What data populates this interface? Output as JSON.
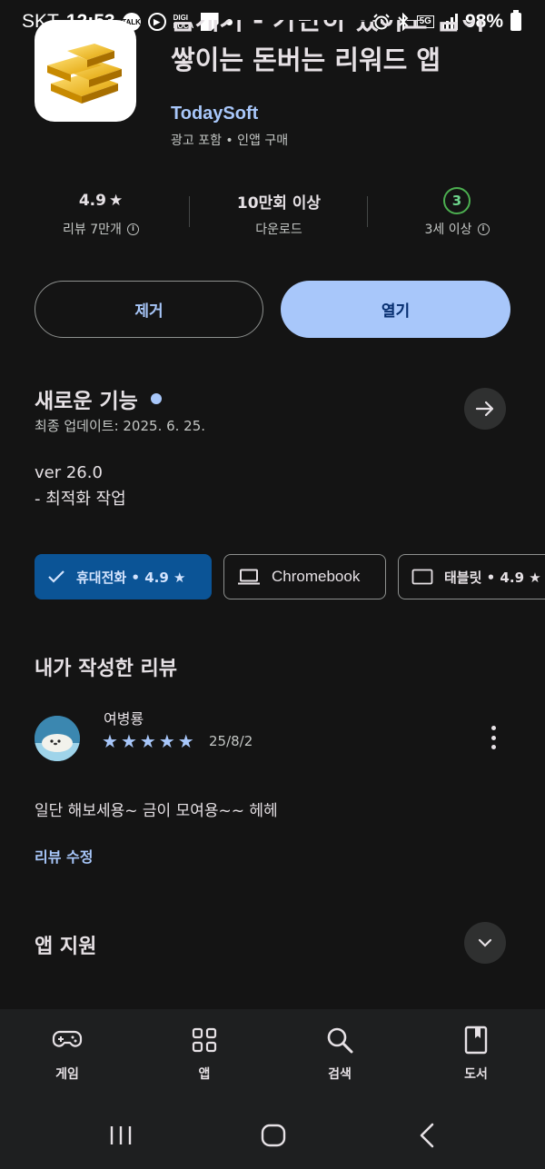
{
  "status_bar": {
    "carrier": "SKT",
    "time": "12:53",
    "talk_icon_text": "TALK",
    "digi_text": "DIGI LOCA",
    "network": "5G",
    "battery": "98%"
  },
  "app": {
    "title_line1": "금캐기 - 가만히 있어도 금이",
    "title_line2": "쌓이는 돈버는 리워드 앱",
    "developer": "TodaySoft",
    "meta": "광고 포함 • 인앱 구매"
  },
  "stats": {
    "rating_value": "4.9",
    "rating_label": "리뷰 7만개",
    "downloads_value": "10만회 이상",
    "downloads_label": "다운로드",
    "age_badge": "3",
    "age_label": "3세 이상"
  },
  "buttons": {
    "remove": "제거",
    "open": "열기"
  },
  "whats_new": {
    "title": "새로운 기능",
    "last_updated": "최종 업데이트: 2025. 6. 25.",
    "version": "ver 26.0",
    "notes": "- 최적화 작업"
  },
  "device_chips": {
    "phone": "휴대전화 • 4.9 ★",
    "chromebook": "Chromebook",
    "tablet": "태블릿 • 4.9 ★"
  },
  "review": {
    "section_title": "내가 작성한 리뷰",
    "author": "여병룡",
    "rating": 5,
    "date": "25/8/2",
    "text": "일단 해보세용~ 금이 모여용~~ 헤헤",
    "edit_label": "리뷰 수정"
  },
  "app_support": {
    "title": "앱 지원"
  },
  "bottom_nav": {
    "games": "게임",
    "apps": "앱",
    "search": "검색",
    "books": "도서"
  },
  "colors": {
    "background": "#141414",
    "accent": "#a8c7fa",
    "chip_selected": "#0b5496"
  }
}
